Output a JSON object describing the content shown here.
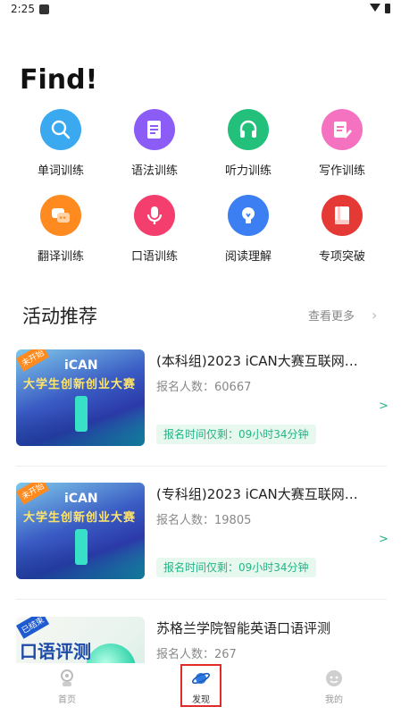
{
  "status_bar": {
    "time": "2:25"
  },
  "header": {
    "title": "Find!"
  },
  "grid": [
    {
      "label": "单词训练",
      "color": "#3aa9f0",
      "icon": "search-icon"
    },
    {
      "label": "语法训练",
      "color": "#8b5cf6",
      "icon": "document-icon"
    },
    {
      "label": "听力训练",
      "color": "#22c07a",
      "icon": "headphones-icon"
    },
    {
      "label": "写作训练",
      "color": "#f472c0",
      "icon": "edit-icon"
    },
    {
      "label": "翻译训练",
      "color": "#ff8a1f",
      "icon": "chat-icon"
    },
    {
      "label": "口语训练",
      "color": "#f43f6e",
      "icon": "microphone-icon"
    },
    {
      "label": "阅读理解",
      "color": "#3b7ff2",
      "icon": "lightbulb-icon"
    },
    {
      "label": "专项突破",
      "color": "#e53935",
      "icon": "book-icon"
    }
  ],
  "section": {
    "title": "活动推荐",
    "see_more": "查看更多",
    "see_more_chevron": "›"
  },
  "cards": [
    {
      "title": "(本科组)2023 iCAN大赛互联网…",
      "count": "报名人数：60667",
      "time": "报名时间仅剩：09小时34分钟",
      "arrow": ">",
      "thumb_badge": "未开始",
      "thumb_brand": "iCAN",
      "thumb_heading": "大学生创新创业大赛"
    },
    {
      "title": "(专科组)2023 iCAN大赛互联网…",
      "count": "报名人数：19805",
      "time": "报名时间仅剩：09小时34分钟",
      "arrow": ">",
      "thumb_badge": "未开始",
      "thumb_brand": "iCAN",
      "thumb_heading": "大学生创新创业大赛"
    },
    {
      "title": "苏格兰学院智能英语口语评测",
      "count": "报名人数：267",
      "arrow": ">",
      "thumb_badge": "已结束",
      "thumb_text": "口语评测"
    }
  ],
  "bottom_nav": [
    {
      "label": "首页",
      "icon": "home-icon",
      "active": false
    },
    {
      "label": "发现",
      "icon": "planet-icon",
      "active": true
    },
    {
      "label": "我的",
      "icon": "profile-icon",
      "active": false
    }
  ],
  "colors": {
    "accent": "#24b487",
    "active_frame": "#e12b2b"
  }
}
